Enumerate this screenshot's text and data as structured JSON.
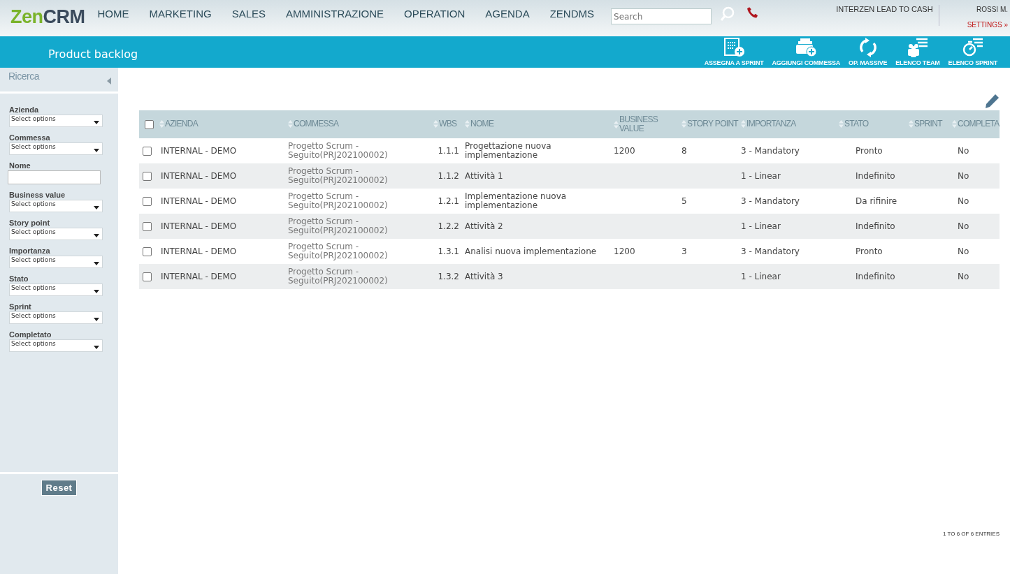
{
  "logo": {
    "part_1": "Zen",
    "part_2": "CRM"
  },
  "nav": [
    {
      "label": "HOME"
    },
    {
      "label": "MARKETING"
    },
    {
      "label": "SALES"
    },
    {
      "label": "AMMINISTRAZIONE"
    },
    {
      "label": "OPERATION"
    },
    {
      "label": "AGENDA"
    },
    {
      "label": "ZENDMS"
    }
  ],
  "search": {
    "placeholder": "Search"
  },
  "company": "INTERZEN LEAD TO CASH",
  "user": {
    "name": "ROSSI M.",
    "settings": "SETTINGS »"
  },
  "page_title": "Product backlog",
  "actions": [
    {
      "kind": "assign",
      "label": "ASSEGNA A SPRINT"
    },
    {
      "kind": "add",
      "label": "AGGIUNGI COMMESSA"
    },
    {
      "kind": "mass",
      "label": "OP. MASSIVE"
    },
    {
      "kind": "team",
      "label": "ELENCO TEAM"
    },
    {
      "kind": "sprint",
      "label": "ELENCO SPRINT"
    }
  ],
  "sidebar": {
    "title": "Ricerca",
    "filters": [
      {
        "kind": "select",
        "label": "Azienda",
        "placeholder": "Select options"
      },
      {
        "kind": "select",
        "label": "Commessa",
        "placeholder": "Select options"
      },
      {
        "kind": "text",
        "label": "Nome"
      },
      {
        "kind": "select",
        "label": "Business value",
        "placeholder": "Select options"
      },
      {
        "kind": "select",
        "label": "Story point",
        "placeholder": "Select options"
      },
      {
        "kind": "select",
        "label": "Importanza",
        "placeholder": "Select options"
      },
      {
        "kind": "select",
        "label": "Stato",
        "placeholder": "Select options"
      },
      {
        "kind": "select",
        "label": "Sprint",
        "placeholder": "Select options"
      },
      {
        "kind": "select",
        "label": "Completato",
        "placeholder": "Select options"
      }
    ],
    "reset": "Reset"
  },
  "table": {
    "all_checked": false,
    "columns": [
      {
        "label": "AZIENDA"
      },
      {
        "label": "COMMESSA"
      },
      {
        "label": "WBS"
      },
      {
        "label": "NOME"
      },
      {
        "label": "BUSINESS VALUE"
      },
      {
        "label": "STORY POINT"
      },
      {
        "label": "IMPORTANZA"
      },
      {
        "label": "STATO"
      },
      {
        "label": "SPRINT"
      },
      {
        "label": "COMPLETA"
      }
    ],
    "rows": [
      {
        "checked": false,
        "cells": [
          "INTERNAL - DEMO",
          "Progetto Scrum - Seguito(PRJ202100002)",
          "1.1.1",
          "Progettazione nuova implementazione",
          "1200",
          "8",
          "3 - Mandatory",
          "Pronto",
          "",
          "No"
        ]
      },
      {
        "checked": false,
        "cells": [
          "INTERNAL - DEMO",
          "Progetto Scrum - Seguito(PRJ202100002)",
          "1.1.2",
          "Attività 1",
          "",
          "",
          "1 - Linear",
          "Indefinito",
          "",
          "No"
        ]
      },
      {
        "checked": false,
        "cells": [
          "INTERNAL - DEMO",
          "Progetto Scrum - Seguito(PRJ202100002)",
          "1.2.1",
          "Implementazione nuova implementazione",
          "",
          "5",
          "3 - Mandatory",
          "Da rifinire",
          "",
          "No"
        ]
      },
      {
        "checked": false,
        "cells": [
          "INTERNAL - DEMO",
          "Progetto Scrum - Seguito(PRJ202100002)",
          "1.2.2",
          "Attività 2",
          "",
          "",
          "1 - Linear",
          "Indefinito",
          "",
          "No"
        ]
      },
      {
        "checked": false,
        "cells": [
          "INTERNAL - DEMO",
          "Progetto Scrum - Seguito(PRJ202100002)",
          "1.3.1",
          "Analisi nuova implementazione",
          "1200",
          "3",
          "3 - Mandatory",
          "Pronto",
          "",
          "No"
        ]
      },
      {
        "checked": false,
        "cells": [
          "INTERNAL - DEMO",
          "Progetto Scrum - Seguito(PRJ202100002)",
          "1.3.2",
          "Attività 3",
          "",
          "",
          "1 - Linear",
          "Indefinito",
          "",
          "No"
        ]
      }
    ]
  },
  "pagination": "1 TO 6 OF 6 ENTRIES"
}
